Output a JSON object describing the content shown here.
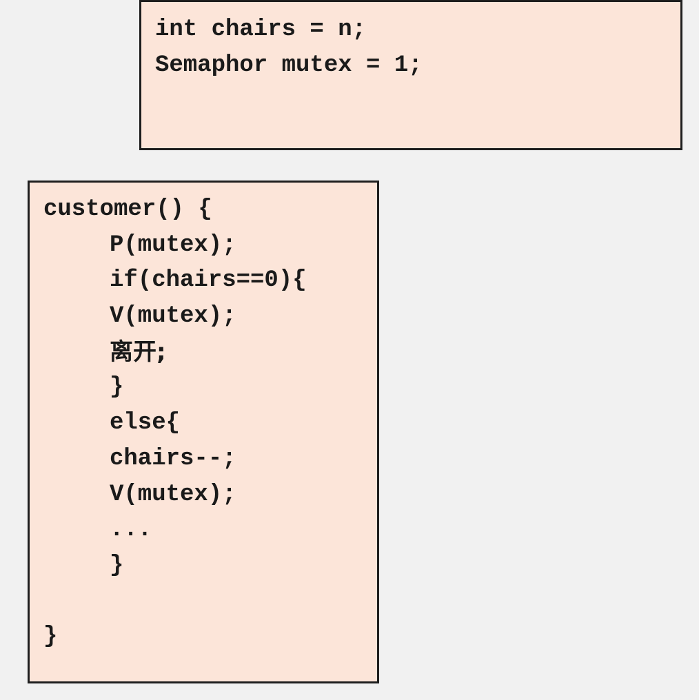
{
  "globals": {
    "lines": [
      "int chairs = n;",
      "Semaphor mutex = 1;"
    ]
  },
  "customer": {
    "lines": [
      "customer() {",
      "P(mutex);",
      "if(chairs==0){",
      "V(mutex);",
      "离开;",
      "}",
      "else{",
      "chairs--;",
      "V(mutex);",
      "...",
      "}",
      "}"
    ]
  }
}
